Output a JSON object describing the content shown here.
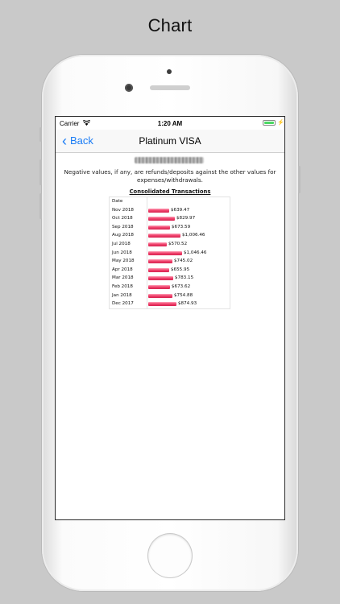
{
  "promo": {
    "title": "Chart"
  },
  "statusbar": {
    "carrier": "Carrier",
    "time": "1:20 AM"
  },
  "navbar": {
    "back_label": "Back",
    "title": "Platinum VISA"
  },
  "content": {
    "note": "Negative values, if any, are refunds/deposits against the other values for expenses/withdrawals.",
    "section_title": "Consolidated Transactions",
    "table_header": "Date"
  },
  "chart_data": {
    "type": "bar",
    "title": "Consolidated Transactions",
    "orientation": "horizontal",
    "categories": [
      "Nov 2018",
      "Oct 2018",
      "Sep 2018",
      "Aug 2018",
      "Jul 2018",
      "Jun 2018",
      "May 2018",
      "Apr 2018",
      "Mar 2018",
      "Feb 2018",
      "Jan 2018",
      "Dec 2017"
    ],
    "values": [
      639.47,
      829.97,
      673.59,
      1006.46,
      570.52,
      1046.46,
      745.02,
      655.95,
      783.15,
      673.62,
      754.88,
      874.93
    ],
    "labels": [
      "$639.47",
      "$829.97",
      "$673.59",
      "$1,006.46",
      "$570.52",
      "$1,046.46",
      "$745.02",
      "$655.95",
      "$783.15",
      "$673.62",
      "$754.88",
      "$874.93"
    ],
    "bar_color": "#e8355f"
  }
}
